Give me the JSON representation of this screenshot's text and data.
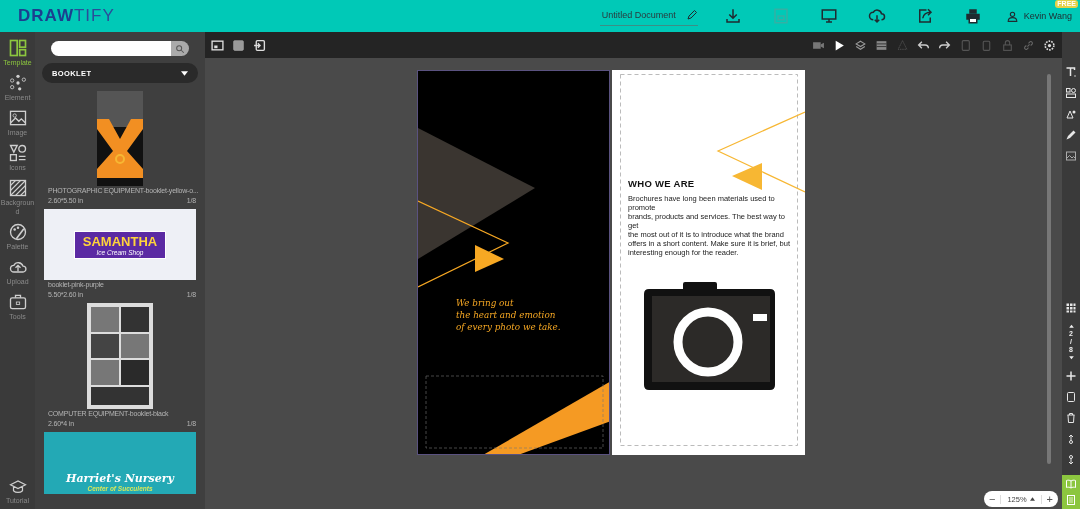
{
  "header": {
    "logo": {
      "first": "DRAW",
      "second": "TIFY"
    },
    "document_title": "Untitled Document",
    "user": {
      "name": "Kevin Wang",
      "badge": "FREE"
    }
  },
  "sidebar": {
    "items": [
      {
        "label": "Template",
        "selected": true
      },
      {
        "label": "Element",
        "selected": false
      },
      {
        "label": "Image",
        "selected": false
      },
      {
        "label": "Icons",
        "selected": false
      },
      {
        "label": "Background",
        "selected": false
      },
      {
        "label": "Palette",
        "selected": false
      },
      {
        "label": "Upload",
        "selected": false
      },
      {
        "label": "Tools",
        "selected": false
      }
    ],
    "tutorial": "Tutorial"
  },
  "template_panel": {
    "category": "BOOKLET",
    "templates": [
      {
        "kind": "portrait-dark",
        "name": "PHOTOGRAPHIC EQUIPMENT-booklet-yellow-o...",
        "size": "2.60*5.50 in",
        "pages": "1/8"
      },
      {
        "kind": "landscape-ice-cream",
        "title": "SAMANTHA",
        "subtitle": "Ice Cream Shop",
        "name": "booklet-pink-purple",
        "size": "5.50*2.60 in",
        "pages": "1/8"
      },
      {
        "kind": "portrait-grey",
        "name": "COMPUTER EQUIPMENT-booklet-black",
        "size": "2.60*4 in",
        "pages": "1/8"
      },
      {
        "kind": "landscape-teal",
        "title": "Harriet's Nursery",
        "subtitle": "Center of Succulents"
      }
    ]
  },
  "canvas": {
    "left_page": {
      "tagline": "We bring out\nthe heart and emotion\nof every photo we take."
    },
    "right_page": {
      "heading": "WHO WE ARE",
      "body": "Brochures have long been materials used to promote\n brands, products and services. The best way to get\nthe most out of it is to introduce what the brand\noffers in a short content. Make sure it is brief, but\ninteresting enough for the reader."
    },
    "zoom": "125%",
    "zoom_out": "−",
    "zoom_in": "+",
    "page_indicator": {
      "current": "2",
      "separator": "/",
      "total": "8"
    }
  }
}
